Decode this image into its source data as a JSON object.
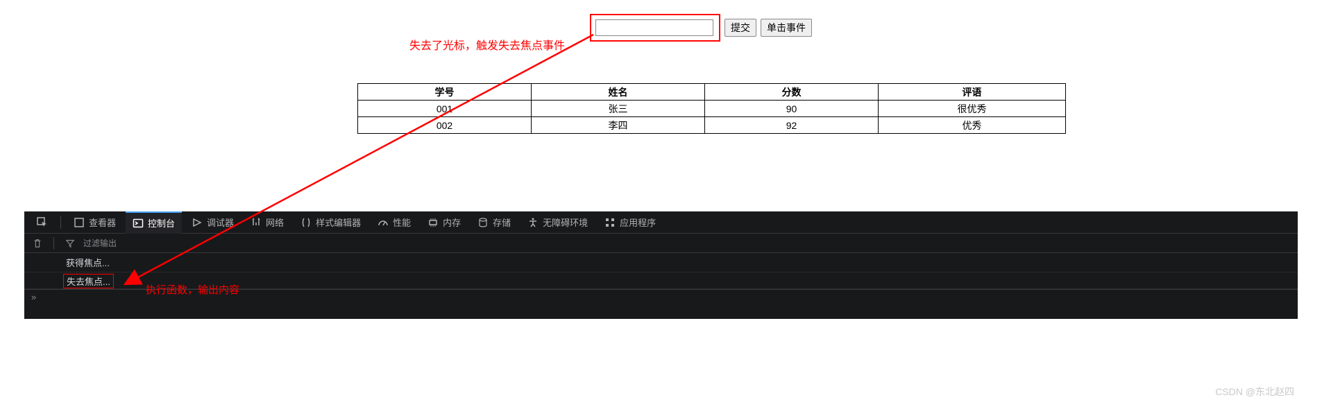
{
  "form": {
    "input_value": "",
    "submit_label": "提交",
    "click_event_label": "单击事件"
  },
  "annotations": {
    "lost_cursor": "失去了光标，触发失去焦点事件",
    "exec_output": "执行函数，输出内容"
  },
  "table": {
    "headers": [
      "学号",
      "姓名",
      "分数",
      "评语"
    ],
    "rows": [
      {
        "id": "001",
        "name": "张三",
        "score": "90",
        "comment": "很优秀"
      },
      {
        "id": "002",
        "name": "李四",
        "score": "92",
        "comment": "优秀"
      }
    ]
  },
  "devtools": {
    "tabs": {
      "inspector": "查看器",
      "console": "控制台",
      "debugger": "调试器",
      "network": "网络",
      "style": "样式编辑器",
      "performance": "性能",
      "memory": "内存",
      "storage": "存储",
      "accessibility": "无障碍环境",
      "application": "应用程序"
    },
    "filter_placeholder": "过滤输出",
    "logs": {
      "gain_focus": "获得焦点...",
      "lose_focus": "失去焦点..."
    },
    "prompt": "»"
  },
  "watermark": "CSDN @东北赵四"
}
